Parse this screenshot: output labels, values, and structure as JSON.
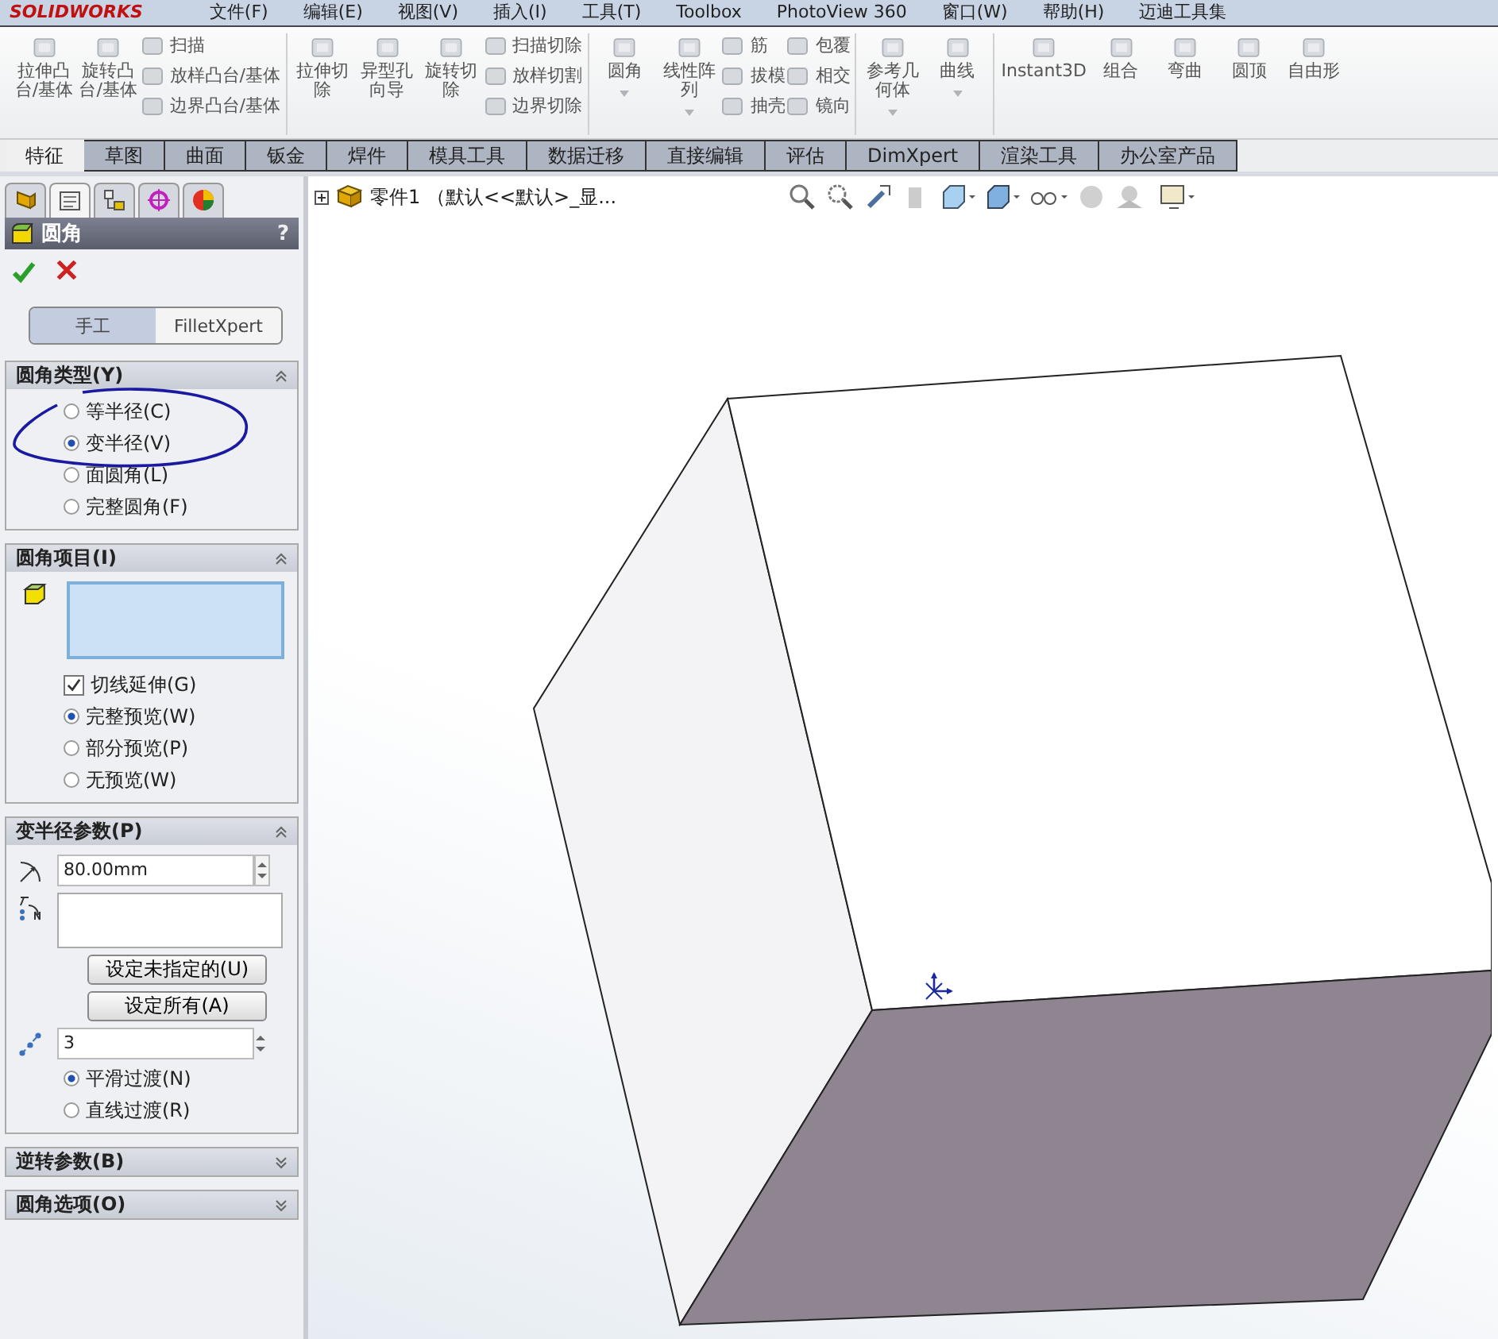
{
  "menu_bar": {
    "logo": "SOLIDWORKS",
    "items": [
      "文件(F)",
      "编辑(E)",
      "视图(V)",
      "插入(I)",
      "工具(T)",
      "Toolbox",
      "PhotoView 360",
      "窗口(W)",
      "帮助(H)",
      "迈迪工具集"
    ]
  },
  "toolbar": {
    "groups": [
      {
        "items": [
          {
            "kind": "large",
            "label": "拉伸凸台/基体",
            "has_menu": false
          },
          {
            "kind": "large",
            "label": "旋转凸台/基体",
            "has_menu": false
          },
          {
            "kind": "stack",
            "entries": [
              "扫描",
              "放样凸台/基体",
              "边界凸台/基体"
            ]
          }
        ]
      },
      {
        "items": [
          {
            "kind": "large",
            "label": "拉伸切除",
            "has_menu": false
          },
          {
            "kind": "large",
            "label": "异型孔向导",
            "has_menu": false
          },
          {
            "kind": "large",
            "label": "旋转切除",
            "has_menu": false
          },
          {
            "kind": "stack",
            "entries": [
              "扫描切除",
              "放样切割",
              "边界切除"
            ]
          }
        ]
      },
      {
        "items": [
          {
            "kind": "large",
            "label": "圆角",
            "has_menu": true
          },
          {
            "kind": "large",
            "label": "线性阵列",
            "has_menu": true
          },
          {
            "kind": "stack",
            "entries": [
              "筋",
              "拔模",
              "抽壳"
            ]
          },
          {
            "kind": "stack",
            "entries": [
              "包覆",
              "相交",
              "镜向"
            ]
          }
        ]
      },
      {
        "items": [
          {
            "kind": "large",
            "label": "参考几何体",
            "has_menu": true
          },
          {
            "kind": "large",
            "label": "曲线",
            "has_menu": true
          }
        ]
      },
      {
        "items": [
          {
            "kind": "large",
            "label": "Instant3D",
            "has_menu": false
          },
          {
            "kind": "large",
            "label": "组合",
            "has_menu": false
          },
          {
            "kind": "large",
            "label": "弯曲",
            "has_menu": false
          },
          {
            "kind": "large",
            "label": "圆顶",
            "has_menu": false
          },
          {
            "kind": "large",
            "label": "自由形",
            "has_menu": false
          }
        ]
      }
    ]
  },
  "tabs": [
    {
      "label": "特征",
      "selected": true
    },
    {
      "label": "草图",
      "selected": false
    },
    {
      "label": "曲面",
      "selected": false
    },
    {
      "label": "钣金",
      "selected": false
    },
    {
      "label": "焊件",
      "selected": false
    },
    {
      "label": "模具工具",
      "selected": false
    },
    {
      "label": "数据迁移",
      "selected": false
    },
    {
      "label": "直接编辑",
      "selected": false
    },
    {
      "label": "评估",
      "selected": false
    },
    {
      "label": "DimXpert",
      "selected": false
    },
    {
      "label": "渲染工具",
      "selected": false
    },
    {
      "label": "办公室产品",
      "selected": false
    }
  ],
  "panel_tabs": [
    {
      "kind": "tree",
      "selected": false
    },
    {
      "kind": "property",
      "selected": true
    },
    {
      "kind": "config",
      "selected": false
    },
    {
      "kind": "dim",
      "selected": false
    },
    {
      "kind": "display",
      "selected": false
    }
  ],
  "property_manager": {
    "title": "圆角",
    "help": "?",
    "mode_tabs": [
      {
        "label": "手工",
        "selected": true
      },
      {
        "label": "FilletXpert",
        "selected": false
      }
    ],
    "sections": [
      {
        "title": "圆角类型(Y)",
        "expanded": true,
        "items": [
          {
            "kind": "radio",
            "label": "等半径(C)",
            "selected": false
          },
          {
            "kind": "radio",
            "label": "变半径(V)",
            "selected": true
          },
          {
            "kind": "radio",
            "label": "面圆角(L)",
            "selected": false
          },
          {
            "kind": "radio",
            "label": "完整圆角(F)",
            "selected": false
          }
        ]
      },
      {
        "title": "圆角项目(I)",
        "expanded": true,
        "items": [
          {
            "kind": "selection_box"
          },
          {
            "kind": "checkbox",
            "label": "切线延伸(G)",
            "checked": true
          },
          {
            "kind": "radio",
            "label": "完整预览(W)",
            "selected": true
          },
          {
            "kind": "radio",
            "label": "部分预览(P)",
            "selected": false
          },
          {
            "kind": "radio",
            "label": "无预览(W)",
            "selected": false
          }
        ]
      },
      {
        "title": "变半径参数(P)",
        "expanded": true,
        "items": [
          {
            "kind": "radius_field",
            "value": "80.00mm"
          },
          {
            "kind": "list_box"
          },
          {
            "kind": "button",
            "label": "设定未指定的(U)"
          },
          {
            "kind": "button",
            "label": "设定所有(A)"
          },
          {
            "kind": "count_field",
            "value": "3"
          },
          {
            "kind": "radio",
            "label": "平滑过渡(N)",
            "selected": true
          },
          {
            "kind": "radio",
            "label": "直线过渡(R)",
            "selected": false
          }
        ]
      },
      {
        "title": "逆转参数(B)",
        "expanded": false
      },
      {
        "title": "圆角选项(O)",
        "expanded": false
      }
    ]
  },
  "viewport": {
    "tree_label": "零件1 （默认<<默认>_显..."
  }
}
